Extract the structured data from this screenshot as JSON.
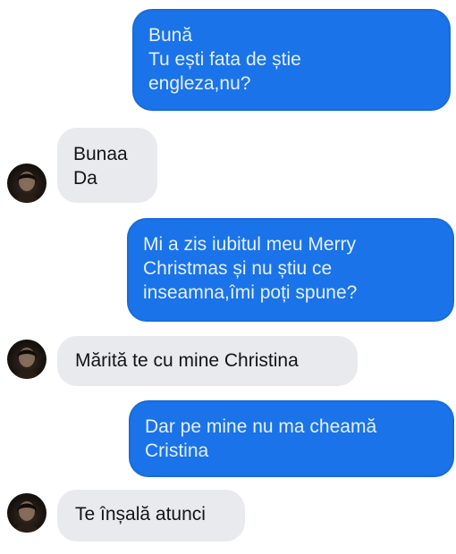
{
  "conversation": {
    "messages": [
      {
        "from": "me",
        "text": "Bună\nTu ești fata de știe\nengleza,nu?"
      },
      {
        "from": "them",
        "text": "Bunaa\nDa"
      },
      {
        "from": "me",
        "text": "Mi a zis iubitul meu Merry\nChristmas și nu știu ce\ninseamna,îmi poți spune?"
      },
      {
        "from": "them",
        "text": "Mărită te cu mine Christina"
      },
      {
        "from": "me",
        "text": "Dar pe mine nu ma cheamă\nCristina"
      },
      {
        "from": "them",
        "text": "Te înșală atunci"
      }
    ]
  },
  "colors": {
    "sent_bubble": "#1a73e8",
    "received_bubble": "#e9eaee",
    "background": "#ffffff"
  },
  "icons": {
    "contact_avatar": "contact-avatar-icon"
  }
}
